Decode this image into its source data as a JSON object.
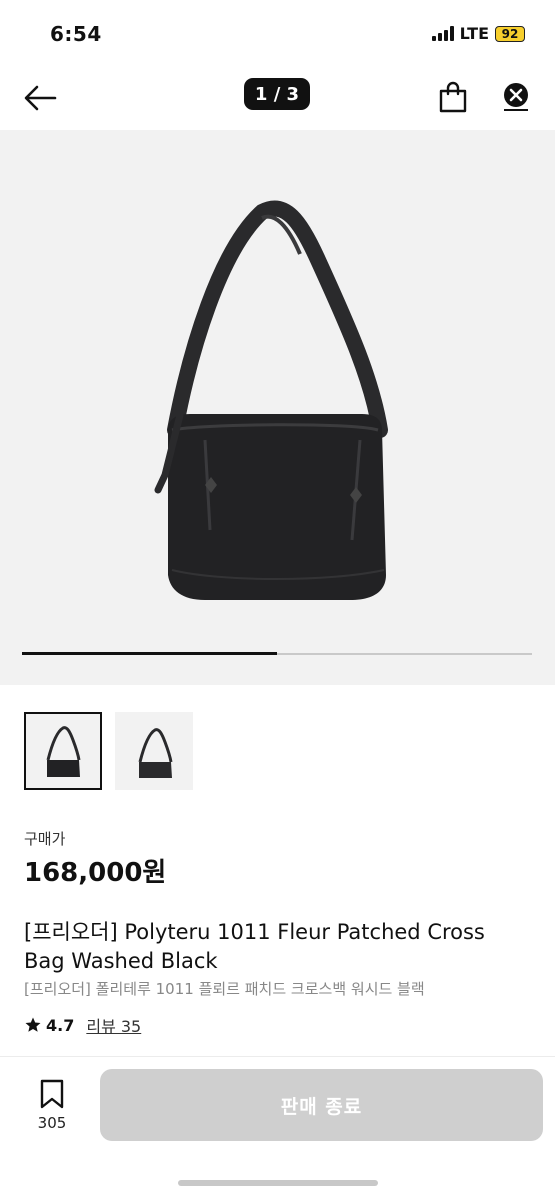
{
  "status_bar": {
    "time": "6:54",
    "network": "LTE",
    "battery": "92"
  },
  "nav": {
    "image_counter": "1 / 3"
  },
  "gallery": {
    "current_image": 1,
    "total_images": 3
  },
  "product": {
    "price_label": "구매가",
    "price": "168,000원",
    "title": "[프리오더] Polyteru 1011 Fleur Patched Cross Bag Washed Black",
    "subtitle": "[프리오더] 폴리테루 1011 플뢰르 패치드 크로스백 워시드 블랙",
    "rating": "4.7",
    "reviews": "리뷰 35"
  },
  "bottom": {
    "wishlist_count": "305",
    "action_label": "판매 종료"
  },
  "colors": {
    "accent": "#111111",
    "disabled_button": "#cfcfcf",
    "hero_bg": "#f2f2f2"
  }
}
